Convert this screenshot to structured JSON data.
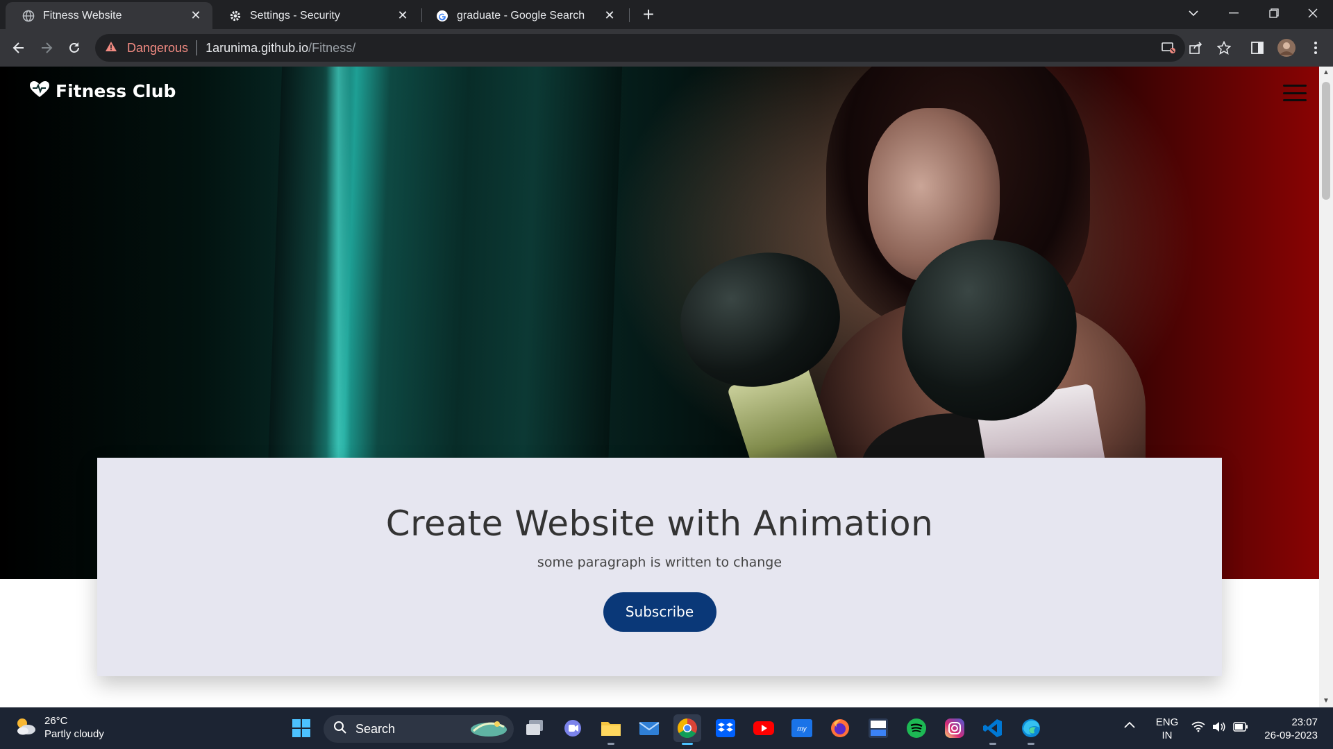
{
  "browser": {
    "tabs": [
      {
        "title": "Fitness Website",
        "active": true,
        "icon": "globe-icon"
      },
      {
        "title": "Settings - Security",
        "active": false,
        "icon": "gear-icon"
      },
      {
        "title": "graduate - Google Search",
        "active": false,
        "icon": "google-icon"
      }
    ],
    "address": {
      "security_label": "Dangerous",
      "host": "1arunima.github.io",
      "path": "/Fitness/"
    },
    "accent_color": "#f28b82"
  },
  "page": {
    "brand": "Fitness Club",
    "brand_icon": "fitness-heart-icon",
    "card": {
      "title": "Create Website with Animation",
      "paragraph": "some paragraph is written to change",
      "button_label": "Subscribe"
    },
    "colors": {
      "button_bg": "#0a3878",
      "card_bg": "#e6e6f0"
    }
  },
  "taskbar": {
    "weather": {
      "temp": "26°C",
      "condition": "Partly cloudy"
    },
    "search_label": "Search",
    "apps": [
      "windows-start-icon",
      "task-view-icon",
      "teams-icon",
      "file-explorer-icon",
      "mail-icon",
      "chrome-icon",
      "dropbox-icon",
      "youtube-icon",
      "mylp-icon",
      "firefox-icon",
      "dev-icon",
      "spotify-icon",
      "instagram-icon",
      "vscode-icon",
      "edge-icon"
    ],
    "language": {
      "line1": "ENG",
      "line2": "IN"
    },
    "clock": {
      "time": "23:07",
      "date": "26-09-2023"
    }
  }
}
